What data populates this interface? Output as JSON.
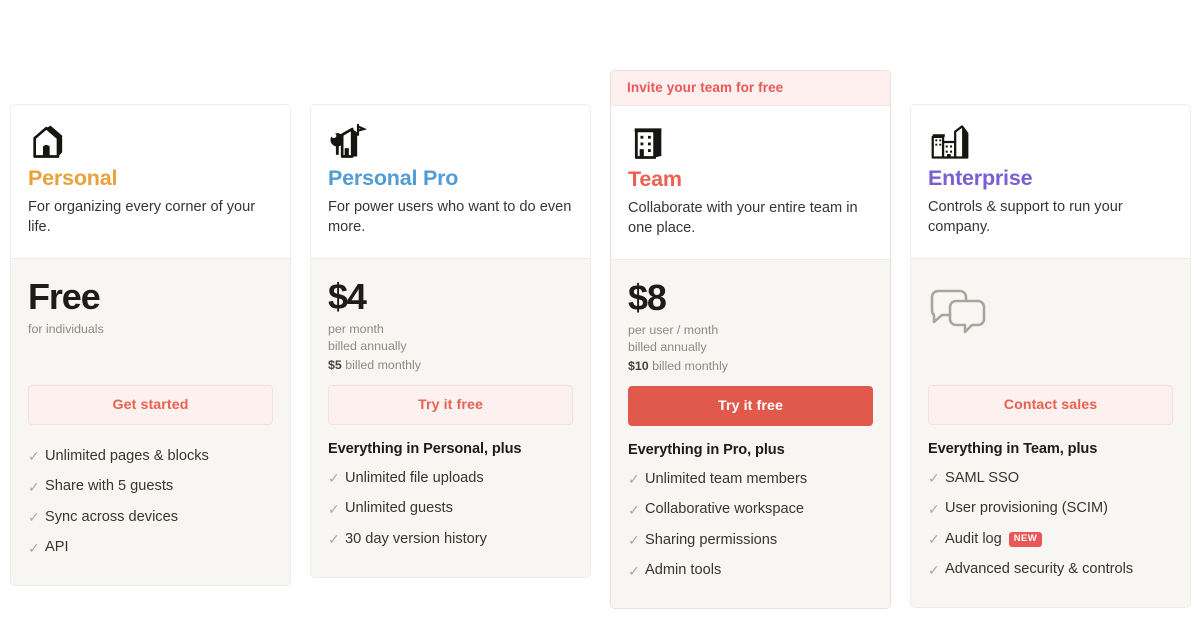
{
  "theme": {
    "page_bg": "#ffffff",
    "card_bg": "#ffffff",
    "card_body_bg": "#f8f6f3",
    "card_border": "#ededea",
    "banner_bg": "#fdf0ee",
    "accent_coral": "#eb5757",
    "cta_solid_bg": "#e0594b",
    "cta_ghost_bg": "#fdf1ef",
    "check_color": "#adaaa4",
    "muted_text": "#8d8a84",
    "body_text": "#37352f"
  },
  "cards": [
    {
      "featured": false,
      "banner": null,
      "icon": "house-icon",
      "name": "Personal",
      "name_color": "#e9a23b",
      "description": "For organizing every corner of your life.",
      "price": "Free",
      "price_lines": [],
      "price_note": "for individuals",
      "price_note_strong": null,
      "price_note_rest": null,
      "show_contact_icon": false,
      "cta_label": "Get started",
      "cta_style": "ghost",
      "feature_heading": null,
      "features": [
        {
          "label": "Unlimited pages & blocks",
          "badge": null
        },
        {
          "label": "Share with 5 guests",
          "badge": null
        },
        {
          "label": "Sync across devices",
          "badge": null
        },
        {
          "label": "API",
          "badge": null
        }
      ]
    },
    {
      "featured": false,
      "banner": null,
      "icon": "house-with-tree-icon",
      "name": "Personal Pro",
      "name_color": "#529cd6",
      "description": "For power users who want to do even more.",
      "price": "$4",
      "price_lines": [
        "per month",
        "billed annually"
      ],
      "price_note": null,
      "price_note_strong": "$5",
      "price_note_rest": " billed monthly",
      "show_contact_icon": false,
      "cta_label": "Try it free",
      "cta_style": "ghost",
      "feature_heading": "Everything in Personal, plus",
      "features": [
        {
          "label": "Unlimited file uploads",
          "badge": null
        },
        {
          "label": "Unlimited guests",
          "badge": null
        },
        {
          "label": "30 day version history",
          "badge": null
        }
      ]
    },
    {
      "featured": true,
      "banner": "Invite your team for free",
      "icon": "office-building-icon",
      "name": "Team",
      "name_color": "#ef5f52",
      "description": "Collaborate with your entire team in one place.",
      "price": "$8",
      "price_lines": [
        "per user / month",
        "billed annually"
      ],
      "price_note": null,
      "price_note_strong": "$10",
      "price_note_rest": " billed monthly",
      "show_contact_icon": false,
      "cta_label": "Try it free",
      "cta_style": "solid",
      "feature_heading": "Everything in Pro, plus",
      "features": [
        {
          "label": "Unlimited team members",
          "badge": null
        },
        {
          "label": "Collaborative workspace",
          "badge": null
        },
        {
          "label": "Sharing permissions",
          "badge": null
        },
        {
          "label": "Admin tools",
          "badge": null
        }
      ]
    },
    {
      "featured": false,
      "banner": null,
      "icon": "city-buildings-icon",
      "name": "Enterprise",
      "name_color": "#7a5fd3",
      "description": "Controls & support to run your company.",
      "price": null,
      "price_lines": [],
      "price_note": null,
      "price_note_strong": null,
      "price_note_rest": null,
      "show_contact_icon": true,
      "contact_icon": "chat-bubbles-icon",
      "cta_label": "Contact sales",
      "cta_style": "ghost",
      "feature_heading": "Everything in Team, plus",
      "features": [
        {
          "label": "SAML SSO",
          "badge": null
        },
        {
          "label": "User provisioning (SCIM)",
          "badge": null
        },
        {
          "label": "Audit log",
          "badge": "NEW"
        },
        {
          "label": "Advanced security & controls",
          "badge": null
        }
      ]
    }
  ],
  "glyphs": {
    "check": "✓"
  }
}
